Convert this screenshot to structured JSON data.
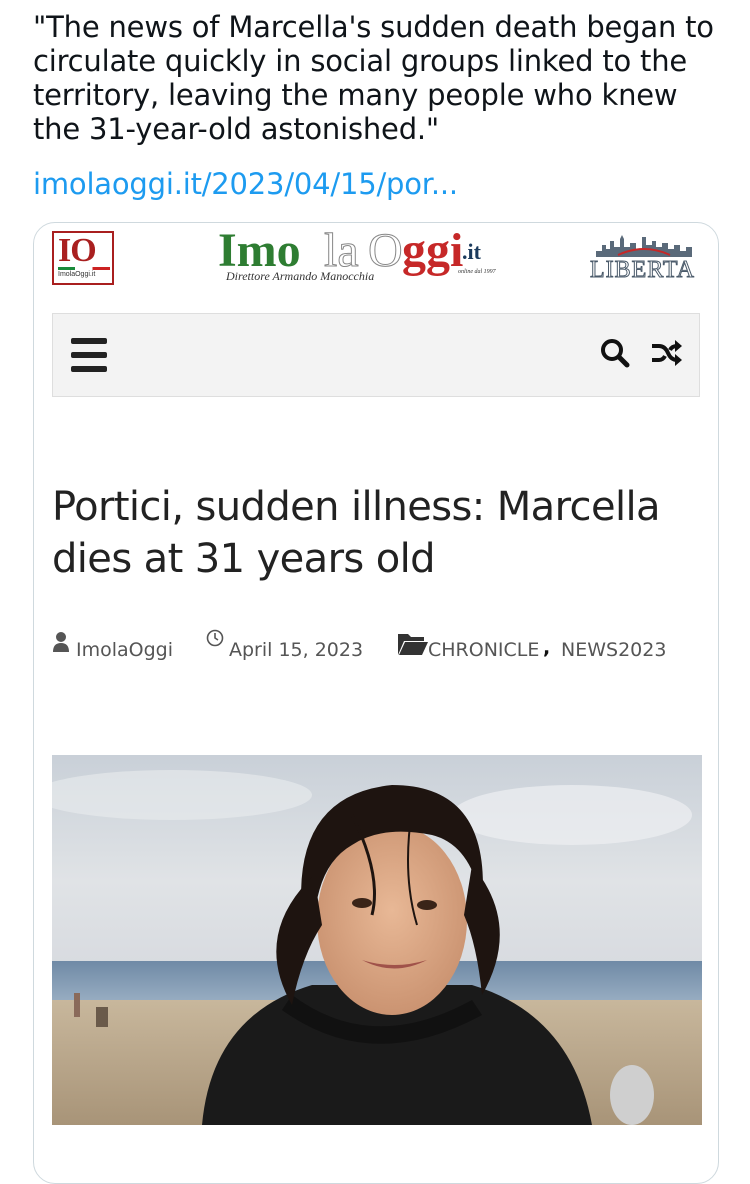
{
  "tweet": {
    "quote": "\"The news of Marcella's sudden death began to circulate quickly in social groups linked to the territory, leaving the many people who knew the 31-year-old astonished.\"",
    "link": "imolaoggi.it/2023/04/15/por..."
  },
  "site": {
    "io_logo_text": "IO",
    "io_logo_sub": "ImolaOggi.it",
    "logo_part_imo": "Imo",
    "logo_part_la": "la",
    "logo_part_o": "O",
    "logo_part_ggi": "ggi",
    "logo_part_it": ".it",
    "director": "Direttore Armando Manocchia",
    "online_since": "online dal 1997",
    "piazza_text": "LIBERTA"
  },
  "nav": {
    "icons": [
      "menu-icon",
      "search-icon",
      "shuffle-icon"
    ]
  },
  "article": {
    "title": "Portici, sudden illness: Marcella dies at 31 years old",
    "author": "ImolaOggi",
    "date": "April 15, 2023",
    "category_1": "CHRONICLE",
    "category_separator": ",",
    "category_2": "NEWS2023"
  },
  "colors": {
    "link": "#1d9bf0",
    "logo_green": "#2e7d32",
    "logo_red": "#c62828",
    "card_border": "#cfd9de"
  }
}
